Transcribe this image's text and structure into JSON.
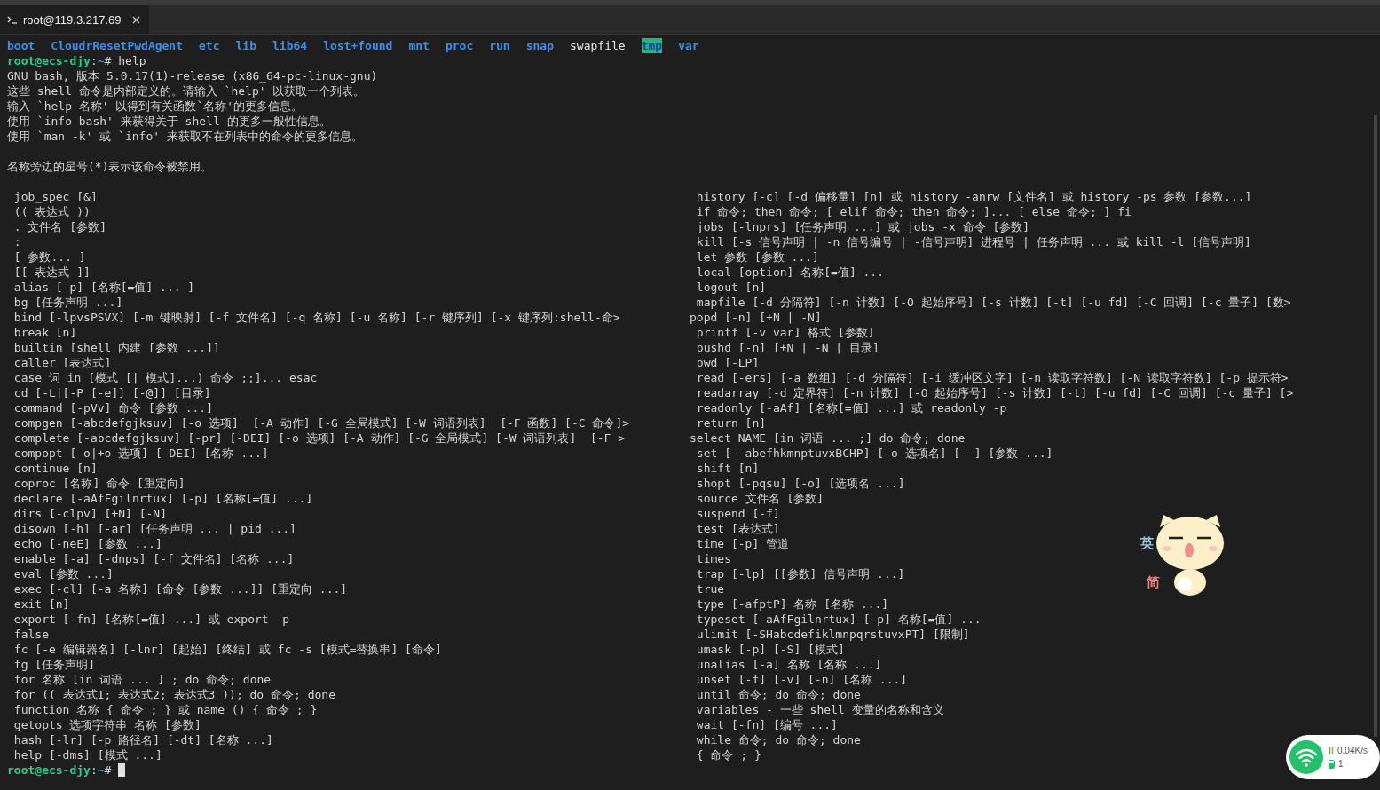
{
  "tab": {
    "title": "root@119.3.217.69",
    "selected": true
  },
  "listing": [
    {
      "name": "boot",
      "kind": "dir"
    },
    {
      "name": "CloudrResetPwdAgent",
      "kind": "dir"
    },
    {
      "name": "etc",
      "kind": "dir"
    },
    {
      "name": "lib",
      "kind": "dir"
    },
    {
      "name": "lib64",
      "kind": "dir"
    },
    {
      "name": "lost+found",
      "kind": "dir"
    },
    {
      "name": "mnt",
      "kind": "dir"
    },
    {
      "name": "proc",
      "kind": "dir"
    },
    {
      "name": "run",
      "kind": "dir"
    },
    {
      "name": "snap",
      "kind": "dir"
    },
    {
      "name": "swapfile",
      "kind": "file"
    },
    {
      "name": "tmp",
      "kind": "sticky"
    },
    {
      "name": "var",
      "kind": "dir"
    }
  ],
  "prompt": {
    "user_host": "root@ecs-djy",
    "separator": ":",
    "path": "~",
    "symbol": "#",
    "command": "help"
  },
  "intro_lines": [
    "GNU bash, 版本 5.0.17(1)-release (x86_64-pc-linux-gnu)",
    "这些 shell 命令是内部定义的。请输入 `help' 以获取一个列表。",
    "输入 `help 名称' 以得到有关函数`名称'的更多信息。",
    "使用 `info bash' 来获得关于 shell 的更多一般性信息。",
    "使用 `man -k' 或 `info' 来获取不在列表中的命令的更多信息。"
  ],
  "note": "名称旁边的星号(*)表示该命令被禁用。",
  "help_table": {
    "left": [
      " job_spec [&]",
      " (( 表达式 ))",
      " . 文件名 [参数]",
      " :",
      " [ 参数... ]",
      " [[ 表达式 ]]",
      " alias [-p] [名称[=值] ... ]",
      " bg [任务声明 ...]",
      " bind [-lpvsPSVX] [-m 键映射] [-f 文件名] [-q 名称] [-u 名称] [-r 键序列] [-x 键序列:shell-命>",
      " break [n]",
      " builtin [shell 内建 [参数 ...]]",
      " caller [表达式]",
      " case 词 in [模式 [| 模式]...) 命令 ;;]... esac",
      " cd [-L|[-P [-e]] [-@]] [目录]",
      " command [-pVv] 命令 [参数 ...]",
      " compgen [-abcdefgjksuv] [-o 选项]  [-A 动作] [-G 全局模式] [-W 词语列表]  [-F 函数] [-C 命令]>",
      " complete [-abcdefgjksuv] [-pr] [-DEI] [-o 选项] [-A 动作] [-G 全局模式] [-W 词语列表]  [-F >",
      " compopt [-o|+o 选项] [-DEI] [名称 ...]",
      " continue [n]",
      " coproc [名称] 命令 [重定向]",
      " declare [-aAfFgilnrtux] [-p] [名称[=值] ...]",
      " dirs [-clpv] [+N] [-N]",
      " disown [-h] [-ar] [任务声明 ... | pid ...]",
      " echo [-neE] [参数 ...]",
      " enable [-a] [-dnps] [-f 文件名] [名称 ...]",
      " eval [参数 ...]",
      " exec [-cl] [-a 名称] [命令 [参数 ...]] [重定向 ...]",
      " exit [n]",
      " export [-fn] [名称[=值] ...] 或 export -p",
      " false",
      " fc [-e 编辑器名] [-lnr] [起始] [终结] 或 fc -s [模式=替换串] [命令]",
      " fg [任务声明]",
      " for 名称 [in 词语 ... ] ; do 命令; done",
      " for (( 表达式1; 表达式2; 表达式3 )); do 命令; done",
      " function 名称 { 命令 ; } 或 name () { 命令 ; }",
      " getopts 选项字符串 名称 [参数]",
      " hash [-lr] [-p 路径名] [-dt] [名称 ...]",
      " help [-dms] [模式 ...]"
    ],
    "right": [
      " history [-c] [-d 偏移量] [n] 或 history -anrw [文件名] 或 history -ps 参数 [参数...]",
      " if 命令; then 命令; [ elif 命令; then 命令; ]... [ else 命令; ] fi",
      " jobs [-lnprs] [任务声明 ...] 或 jobs -x 命令 [参数]",
      " kill [-s 信号声明 | -n 信号编号 | -信号声明] 进程号 | 任务声明 ... 或 kill -l [信号声明]",
      " let 参数 [参数 ...]",
      " local [option] 名称[=值] ...",
      " logout [n]",
      " mapfile [-d 分隔符] [-n 计数] [-O 起始序号] [-s 计数] [-t] [-u fd] [-C 回调] [-c 量子] [数>",
      "popd [-n] [+N | -N]",
      " printf [-v var] 格式 [参数]",
      " pushd [-n] [+N | -N | 目录]",
      " pwd [-LP]",
      " read [-ers] [-a 数组] [-d 分隔符] [-i 缓冲区文字] [-n 读取字符数] [-N 读取字符数] [-p 提示符>",
      " readarray [-d 定界符] [-n 计数] [-O 起始序号] [-s 计数] [-t] [-u fd] [-C 回调] [-c 量子] [>",
      " readonly [-aAf] [名称[=值] ...] 或 readonly -p",
      " return [n]",
      "select NAME [in 词语 ... ;] do 命令; done",
      " set [--abefhkmnptuvxBCHP] [-o 选项名] [--] [参数 ...]",
      " shift [n]",
      " shopt [-pqsu] [-o] [选项名 ...]",
      " source 文件名 [参数]",
      " suspend [-f]",
      " test [表达式]",
      " time [-p] 管道",
      " times",
      " trap [-lp] [[参数] 信号声明 ...]",
      " true",
      " type [-afptP] 名称 [名称 ...]",
      " typeset [-aAfFgilnrtux] [-p] 名称[=值] ...",
      " ulimit [-SHabcdefiklmnpqrstuvxPT] [限制]",
      " umask [-p] [-S] [模式]",
      " unalias [-a] 名称 [名称 ...]",
      " unset [-f] [-v] [-n] [名称 ...]",
      " until 命令; do 命令; done",
      " variables - 一些 shell 变量的名称和含义",
      " wait [-fn] [编号 ...]",
      " while 命令; do 命令; done",
      " { 命令 ; }"
    ]
  },
  "final_prompt": {
    "user_host": "root@ecs-djy",
    "separator": ":",
    "path": "~",
    "symbol": "#"
  },
  "ime_mascot": {
    "mode_top": "英",
    "mode_bottom": "简"
  },
  "network_widget": {
    "speed": "0.04K/s",
    "count": "1"
  }
}
